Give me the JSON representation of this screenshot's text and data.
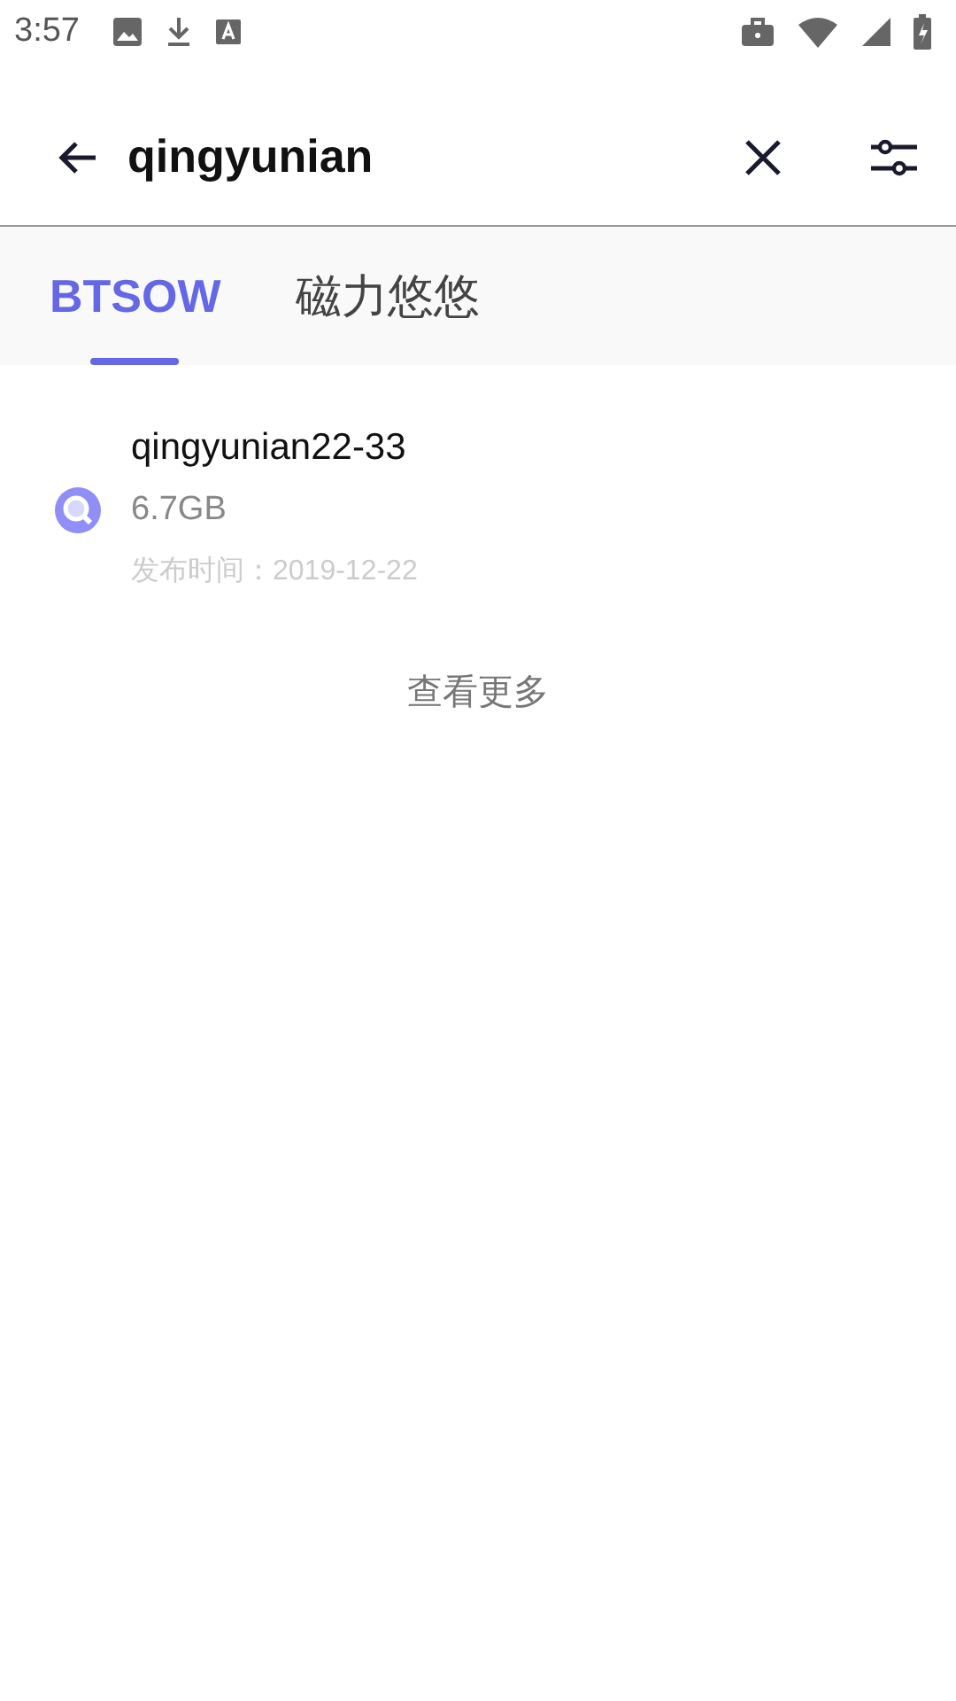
{
  "status_bar": {
    "time": "3:57"
  },
  "search": {
    "value": "qingyunian"
  },
  "tabs": [
    {
      "label": "BTSOW",
      "selected": true
    },
    {
      "label": "磁力悠悠",
      "selected": false
    }
  ],
  "results": [
    {
      "title": "qingyunian22-33",
      "size": "6.7GB",
      "date": "发布时间：2019-12-22"
    }
  ],
  "more_button": "查看更多"
}
